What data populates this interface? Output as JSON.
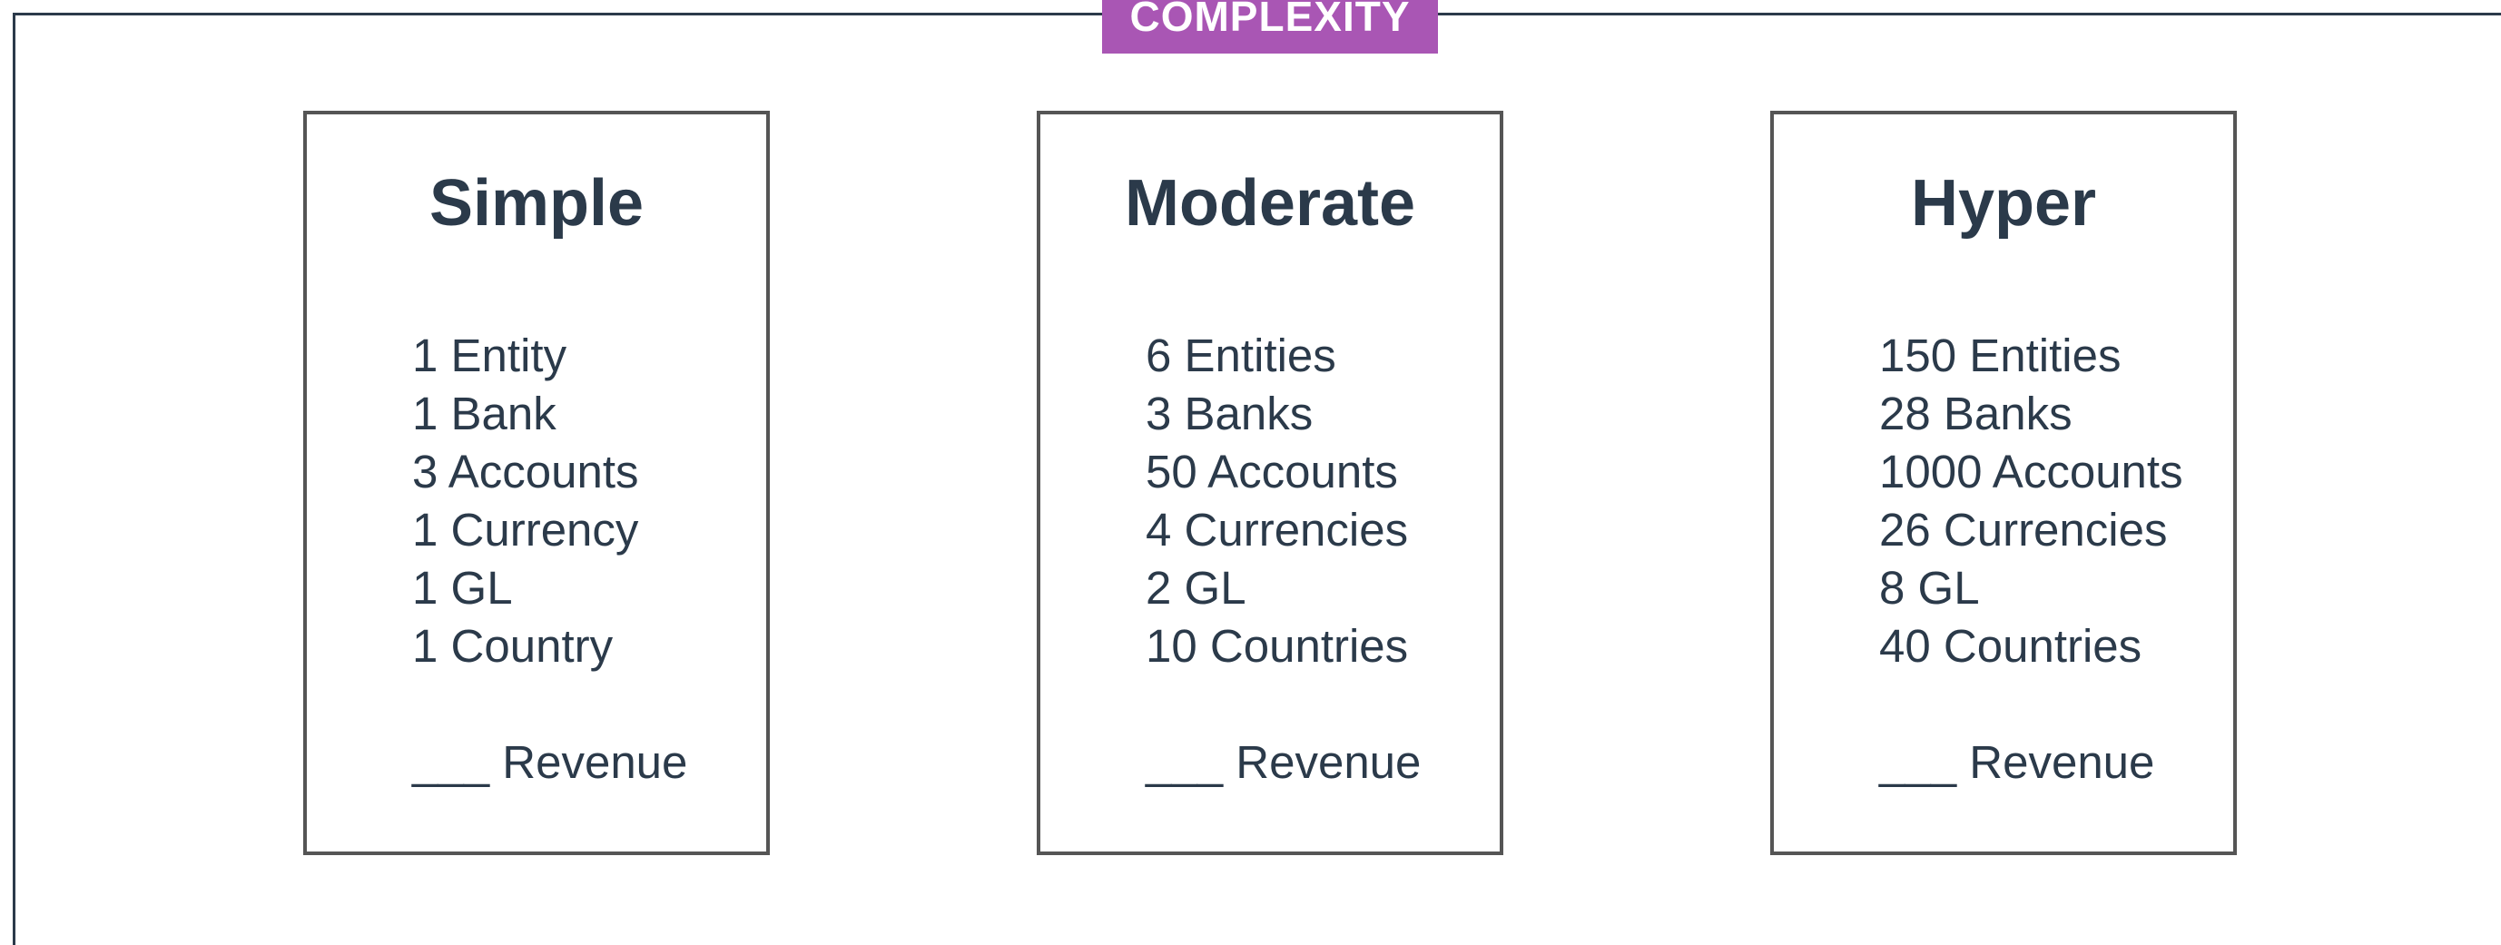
{
  "banner": {
    "label": "COMPLEXITY",
    "color": "#a956b4"
  },
  "tiers": [
    {
      "title": "Simple",
      "items": [
        "1 Entity",
        "1 Bank",
        "3 Accounts",
        "1 Currency",
        "1 GL",
        "1 Country"
      ],
      "revenue": "___ Revenue"
    },
    {
      "title": "Moderate",
      "items": [
        "6 Entities",
        "3 Banks",
        "50 Accounts",
        "4 Currencies",
        "2 GL",
        "10 Countries"
      ],
      "revenue": "___ Revenue"
    },
    {
      "title": "Hyper",
      "items": [
        "150 Entities",
        "28 Banks",
        "1000 Accounts",
        "26 Currencies",
        "8 GL",
        "40 Countries"
      ],
      "revenue": "___ Revenue"
    }
  ]
}
